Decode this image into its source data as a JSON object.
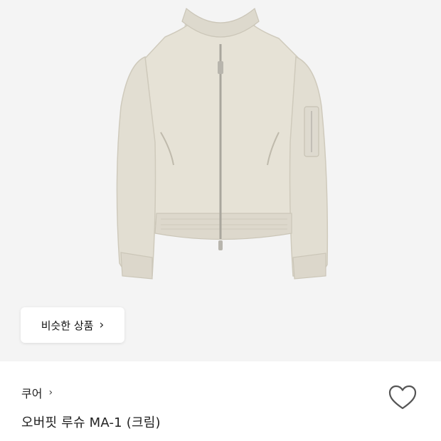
{
  "product": {
    "image_icon": "jacket-image",
    "similar_button_label": "비슷한 상품",
    "similar_button_icon": "chevron-right-icon",
    "brand": "쿠어",
    "brand_icon": "chevron-right-icon",
    "name": "오버핏 루슈 MA-1 (크림)",
    "wishlist_icon": "heart-icon"
  },
  "colors": {
    "image_background": "#f4f4f4",
    "jacket": "#e6e2d6",
    "text": "#222222"
  }
}
